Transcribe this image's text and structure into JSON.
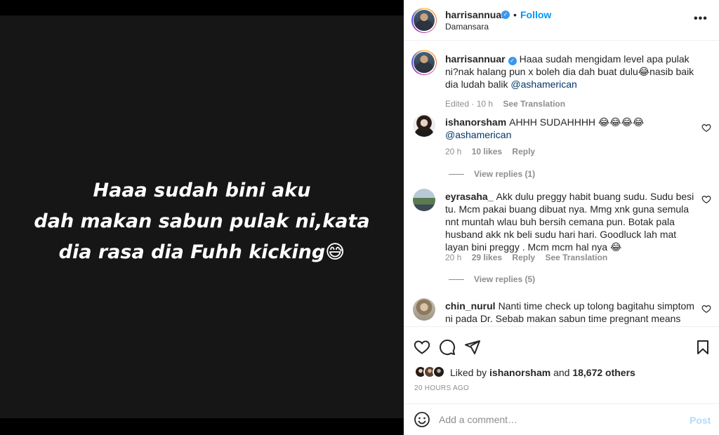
{
  "media": {
    "caption_lines": [
      "Haaa sudah bini aku",
      "dah makan sabun pulak ni,kata",
      "dia rasa dia Fuhh kicking😅"
    ]
  },
  "header": {
    "username": "harrisannuar",
    "verified_icon": "verified-badge-icon",
    "dot": "•",
    "follow_label": "Follow",
    "location": "Damansara",
    "more_icon": "more-options-icon",
    "more_label": "•••"
  },
  "caption": {
    "username": "harrisannuar",
    "text": "Haaa sudah mengidam level apa pulak ni?nak halang pun x boleh dia dah buat dulu😂nasib baik dia ludah balik",
    "mention": "@ashamerican",
    "edited": "Edited · 10 h",
    "see_translation": "See Translation"
  },
  "comments": [
    {
      "username": "ishanorsham",
      "text": "AHHH SUDAHHHH 😂😂😂😂",
      "mention": "@ashamerican",
      "time": "20 h",
      "likes": "10 likes",
      "reply": "Reply",
      "view_replies": "View replies (1)"
    },
    {
      "username": "eyrasaha_",
      "text": "Akk dulu preggy habit buang sudu. Sudu besi tu. Mcm pakai buang dibuat nya. Mmg xnk guna semula nnt muntah wlau buh bersih cemana pun. Botak pala husband akk nk beli sudu hari hari. Goodluck lah mat layan bini preggy . Mcm mcm hal nya 😂",
      "time": "20 h",
      "likes": "29 likes",
      "reply": "Reply",
      "see_translation": "See Translation",
      "view_replies": "View replies (5)"
    },
    {
      "username": "chin_nurul",
      "text": "Nanti time check up tolong bagitahu simptom ni pada Dr. Sebab makan sabun time pregnant means ada nutrition masalah"
    }
  ],
  "actions": {
    "like_icon": "heart-icon",
    "comment_icon": "comment-icon",
    "share_icon": "share-icon",
    "save_icon": "bookmark-icon"
  },
  "likes": {
    "prefix": "Liked by ",
    "user": "ishanorsham",
    "middle": " and ",
    "count": "18,672 others"
  },
  "timestamp": "20 HOURS AGO",
  "add_comment": {
    "placeholder": "Add a comment…",
    "post_label": "Post",
    "emoji_icon": "emoji-icon"
  },
  "colors": {
    "accent": "#0095f6",
    "verified": "#3897f0",
    "mention": "#00376b",
    "muted": "#8e8e8e",
    "post_disabled": "#b3dbff",
    "media_bg": "#161616"
  }
}
